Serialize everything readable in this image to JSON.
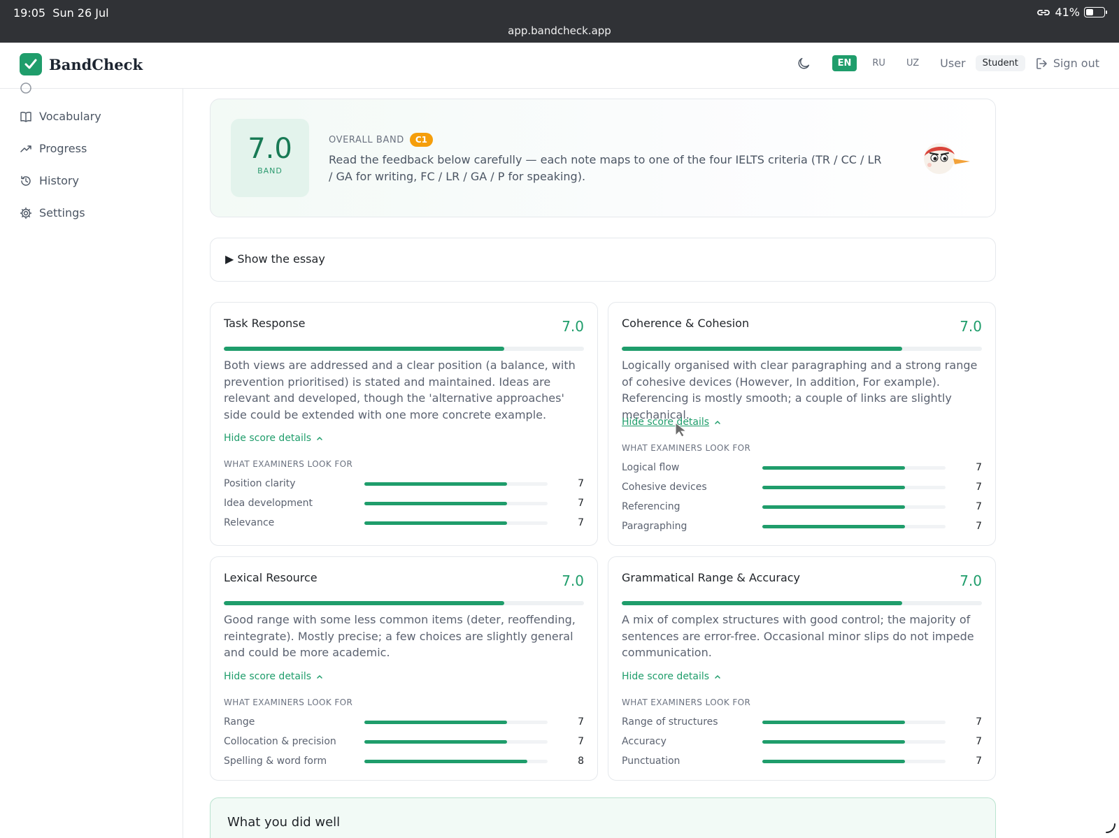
{
  "status_bar": {
    "time": "19:05",
    "date": "Sun 26 Jul",
    "url": "app.bandcheck.app",
    "battery": "41%",
    "battery_level": 0.41
  },
  "header": {
    "brand": "BandCheck",
    "languages": [
      {
        "code": "EN",
        "active": true
      },
      {
        "code": "RU",
        "active": false
      },
      {
        "code": "UZ",
        "active": false
      }
    ],
    "user_label": "User",
    "role": "Student",
    "sign_out": "Sign out",
    "theme_icon": "moon-icon"
  },
  "sidebar": {
    "items": [
      {
        "label": "Vocabulary",
        "icon": "book-icon"
      },
      {
        "label": "Progress",
        "icon": "trend-up-icon"
      },
      {
        "label": "History",
        "icon": "history-icon"
      },
      {
        "label": "Settings",
        "icon": "gear-icon"
      }
    ]
  },
  "overall": {
    "score": "7.0",
    "band_label": "BAND",
    "label": "OVERALL BAND",
    "cefr": "C1",
    "description": "Read the feedback below carefully — each note maps to one of the four IELTS criteria (TR / CC / LR / GA for writing, FC / LR / GA / P for speaking)."
  },
  "essay_toggle": {
    "label": "▶ Show the essay"
  },
  "criteria": [
    {
      "title": "Task Response",
      "score": "7.0",
      "fraction": 0.7778,
      "text": "Both views are addressed and a clear position (a balance, with prevention prioritised) is stated and maintained. Ideas are relevant and developed, though the 'alternative approaches' side could be extended with one more concrete example.",
      "hide_label": "Hide score details",
      "section_label": "WHAT EXAMINERS LOOK FOR",
      "subs": [
        {
          "label": "Position clarity",
          "value": "7",
          "fraction": 0.7778
        },
        {
          "label": "Idea development",
          "value": "7",
          "fraction": 0.7778
        },
        {
          "label": "Relevance",
          "value": "7",
          "fraction": 0.7778
        }
      ]
    },
    {
      "title": "Coherence & Cohesion",
      "score": "7.0",
      "fraction": 0.7778,
      "text": "Logically organised with clear paragraphing and a strong range of cohesive devices (However, In addition, For example). Referencing is mostly smooth; a couple of links are slightly mechanical.",
      "hide_label": "Hide score details",
      "section_label": "WHAT EXAMINERS LOOK FOR",
      "subs": [
        {
          "label": "Logical flow",
          "value": "7",
          "fraction": 0.7778
        },
        {
          "label": "Cohesive devices",
          "value": "7",
          "fraction": 0.7778
        },
        {
          "label": "Referencing",
          "value": "7",
          "fraction": 0.7778
        },
        {
          "label": "Paragraphing",
          "value": "7",
          "fraction": 0.7778
        }
      ]
    },
    {
      "title": "Lexical Resource",
      "score": "7.0",
      "fraction": 0.7778,
      "text": "Good range with some less common items (deter, reoffending, reintegrate). Mostly precise; a few choices are slightly general and could be more academic.",
      "hide_label": "Hide score details",
      "section_label": "WHAT EXAMINERS LOOK FOR",
      "subs": [
        {
          "label": "Range",
          "value": "7",
          "fraction": 0.7778
        },
        {
          "label": "Collocation & precision",
          "value": "7",
          "fraction": 0.7778
        },
        {
          "label": "Spelling & word form",
          "value": "8",
          "fraction": 0.8889
        }
      ]
    },
    {
      "title": "Grammatical Range & Accuracy",
      "score": "7.0",
      "fraction": 0.7778,
      "text": "A mix of complex structures with good control; the majority of sentences are error-free. Occasional minor slips do not impede communication.",
      "hide_label": "Hide score details",
      "section_label": "WHAT EXAMINERS LOOK FOR",
      "subs": [
        {
          "label": "Range of structures",
          "value": "7",
          "fraction": 0.7778
        },
        {
          "label": "Accuracy",
          "value": "7",
          "fraction": 0.7778
        },
        {
          "label": "Punctuation",
          "value": "7",
          "fraction": 0.7778
        }
      ]
    }
  ],
  "well_section": {
    "title": "What you did well"
  },
  "colors": {
    "accent": "#1f9d6b",
    "cefr": "#f59e0b",
    "statusbar": "#303236"
  }
}
